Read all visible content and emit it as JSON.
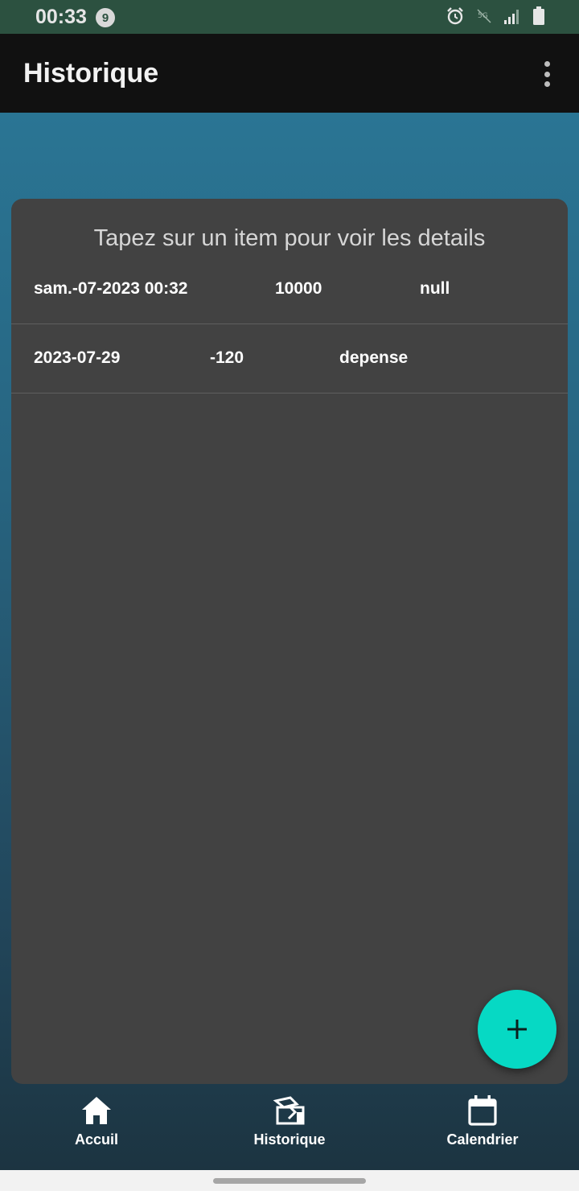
{
  "status_bar": {
    "time": "00:33",
    "notification_count": "9",
    "icons": [
      "alarm-icon",
      "no-5g-icon",
      "signal-icon",
      "battery-icon"
    ]
  },
  "app_bar": {
    "title": "Historique",
    "menu_icon": "more-vert-icon"
  },
  "list": {
    "hint": "Tapez sur un item pour voir les details",
    "rows": [
      {
        "date": "sam.-07-2023 00:32",
        "amount": "10000",
        "category": "null"
      },
      {
        "date": "2023-07-29",
        "amount": "-120",
        "category": "depense"
      }
    ]
  },
  "fab": {
    "icon": "plus-icon"
  },
  "bottom_nav": {
    "items": [
      {
        "label": "Accuil",
        "icon": "home-icon"
      },
      {
        "label": "Historique",
        "icon": "history-icon"
      },
      {
        "label": "Calendrier",
        "icon": "calendar-icon"
      }
    ]
  },
  "colors": {
    "status_bar": "#2c5140",
    "app_bar": "#111111",
    "card": "#424242",
    "fab": "#06d9c4",
    "gradient_top": "#2a7594",
    "gradient_bottom": "#1c3441"
  }
}
